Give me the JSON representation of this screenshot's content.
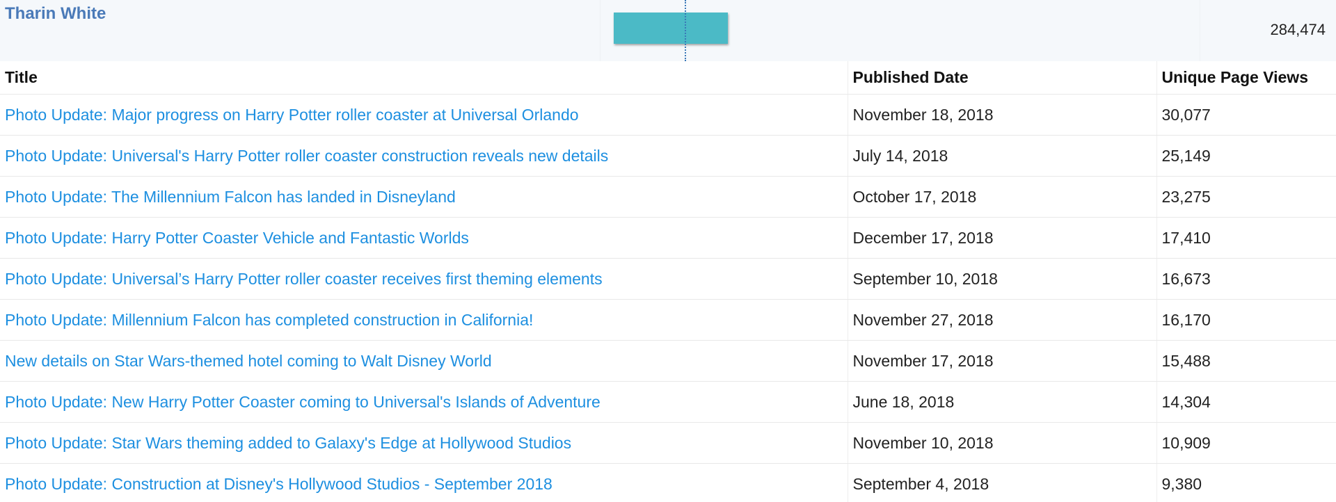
{
  "author": {
    "name": "Tharin White",
    "total_views": "284,474",
    "bar_fill_fraction": 0.19
  },
  "colors": {
    "author_name": "#4a7ab8",
    "link": "#1d8fe0",
    "bar": "#4bbac6",
    "ref_line": "#3a78b8",
    "summary_bg": "#f5f8fb"
  },
  "table": {
    "headers": {
      "title": "Title",
      "published_date": "Published Date",
      "unique_page_views": "Unique Page Views"
    },
    "rows": [
      {
        "title": "Photo Update: Major progress on Harry Potter roller coaster at Universal Orlando",
        "date": "November 18, 2018",
        "views": "30,077"
      },
      {
        "title": "Photo Update: Universal's Harry Potter roller coaster construction reveals new details",
        "date": "July 14, 2018",
        "views": "25,149"
      },
      {
        "title": "Photo Update: The Millennium Falcon has landed in Disneyland",
        "date": "October 17, 2018",
        "views": "23,275"
      },
      {
        "title": "Photo Update: Harry Potter Coaster Vehicle and Fantastic Worlds",
        "date": "December 17, 2018",
        "views": "17,410"
      },
      {
        "title": "Photo Update: Universal’s Harry Potter roller coaster receives first theming elements",
        "date": "September 10, 2018",
        "views": "16,673"
      },
      {
        "title": "Photo Update: Millennium Falcon has completed construction in California!",
        "date": "November 27, 2018",
        "views": "16,170"
      },
      {
        "title": "New details on Star Wars-themed hotel coming to Walt Disney World",
        "date": "November 17, 2018",
        "views": "15,488"
      },
      {
        "title": "Photo Update: New Harry Potter Coaster coming to Universal's Islands of Adventure",
        "date": "June 18, 2018",
        "views": "14,304"
      },
      {
        "title": "Photo Update: Star Wars theming added to Galaxy's Edge at Hollywood Studios",
        "date": "November 10, 2018",
        "views": "10,909"
      },
      {
        "title": "Photo Update: Construction at Disney's Hollywood Studios - September 2018",
        "date": "September 4, 2018",
        "views": "9,380"
      }
    ]
  }
}
